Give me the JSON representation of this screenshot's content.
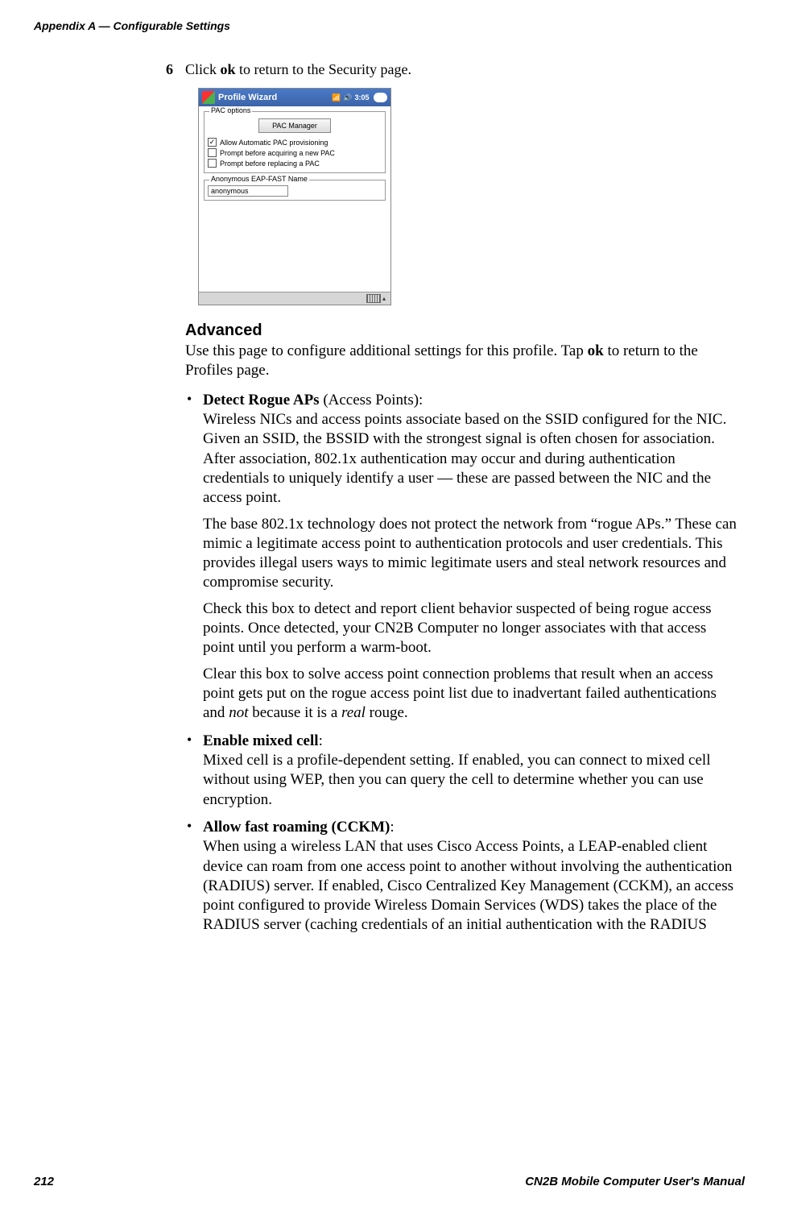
{
  "header": "Appendix A — Configurable Settings",
  "step": {
    "number": "6",
    "prefix": "Click ",
    "bold": "ok",
    "suffix": " to return to the Security page."
  },
  "screenshot": {
    "title": "Profile Wizard",
    "signal_icon": "signal-icon",
    "speaker_icon": "speaker-icon",
    "time": "3:05",
    "ok": "ok",
    "fieldset1": {
      "legend": "PAC options",
      "pac_manager_btn": "PAC Manager",
      "checks": [
        {
          "checked": true,
          "label": "Allow Automatic PAC provisioning"
        },
        {
          "checked": false,
          "label": "Prompt before acquiring a new PAC"
        },
        {
          "checked": false,
          "label": "Prompt before replacing a PAC"
        }
      ]
    },
    "fieldset2": {
      "legend": "Anonymous EAP-FAST Name",
      "value": "anonymous"
    }
  },
  "advanced": {
    "heading": "Advanced",
    "intro_pre": "Use this page to configure additional settings for this profile. Tap ",
    "intro_bold": "ok",
    "intro_post": " to return to the Profiles page.",
    "items": [
      {
        "title": "Detect Rogue APs",
        "title_suffix": " (Access Points):",
        "p1": "Wireless NICs and access points associate based on the SSID configured for the NIC. Given an SSID, the BSSID with the strongest signal is often chosen for association. After association, 802.1x authentication may occur and during authentication credentials to uniquely identify a user — these are passed between the NIC and the access point.",
        "p2": "The base 802.1x technology does not protect the network from “rogue APs.” These can mimic a legitimate access point to authentication protocols and user credentials. This provides illegal users ways to mimic legitimate users and steal network resources and compromise security.",
        "p3": "Check this box to detect and report client behavior suspected of being rogue access points. Once detected, your CN2B Computer no longer associates with that access point until you perform a warm-boot.",
        "p4_pre": "Clear this box to solve access point connection problems that result when an access point gets put on the rogue access point list due to inadvertant failed authentications and ",
        "p4_it1": "not",
        "p4_mid": " because it is a ",
        "p4_it2": "real",
        "p4_post": " rouge."
      },
      {
        "title": "Enable mixed cell",
        "title_suffix": ":",
        "p1": "Mixed cell is a profile-dependent setting. If enabled, you can connect to mixed cell without using WEP, then you can query the cell to determine whether you can use encryption."
      },
      {
        "title": "Allow fast roaming (CCKM)",
        "title_suffix": ":",
        "p1": "When using a wireless LAN that uses Cisco Access Points, a LEAP-enabled client device can roam from one access point to another without involving the authentication (RADIUS) server. If enabled, Cisco Centralized Key Management (CCKM), an access point configured to provide Wireless Domain Services (WDS) takes the place of the RADIUS server (caching credentials of an initial authentication with the RADIUS"
      }
    ]
  },
  "footer": {
    "page": "212",
    "manual": "CN2B Mobile Computer User's Manual"
  }
}
